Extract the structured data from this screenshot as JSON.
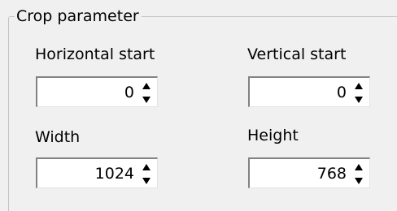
{
  "group": {
    "title": "Crop parameter"
  },
  "fields": {
    "horizontal_start": {
      "label": "Horizontal start",
      "value": "0"
    },
    "vertical_start": {
      "label": "Vertical start",
      "value": "0"
    },
    "width": {
      "label": "Width",
      "value": "1024"
    },
    "height": {
      "label": "Height",
      "value": "768"
    }
  },
  "icons": {
    "up": "spin-up-arrow-icon",
    "down": "spin-down-arrow-icon"
  }
}
